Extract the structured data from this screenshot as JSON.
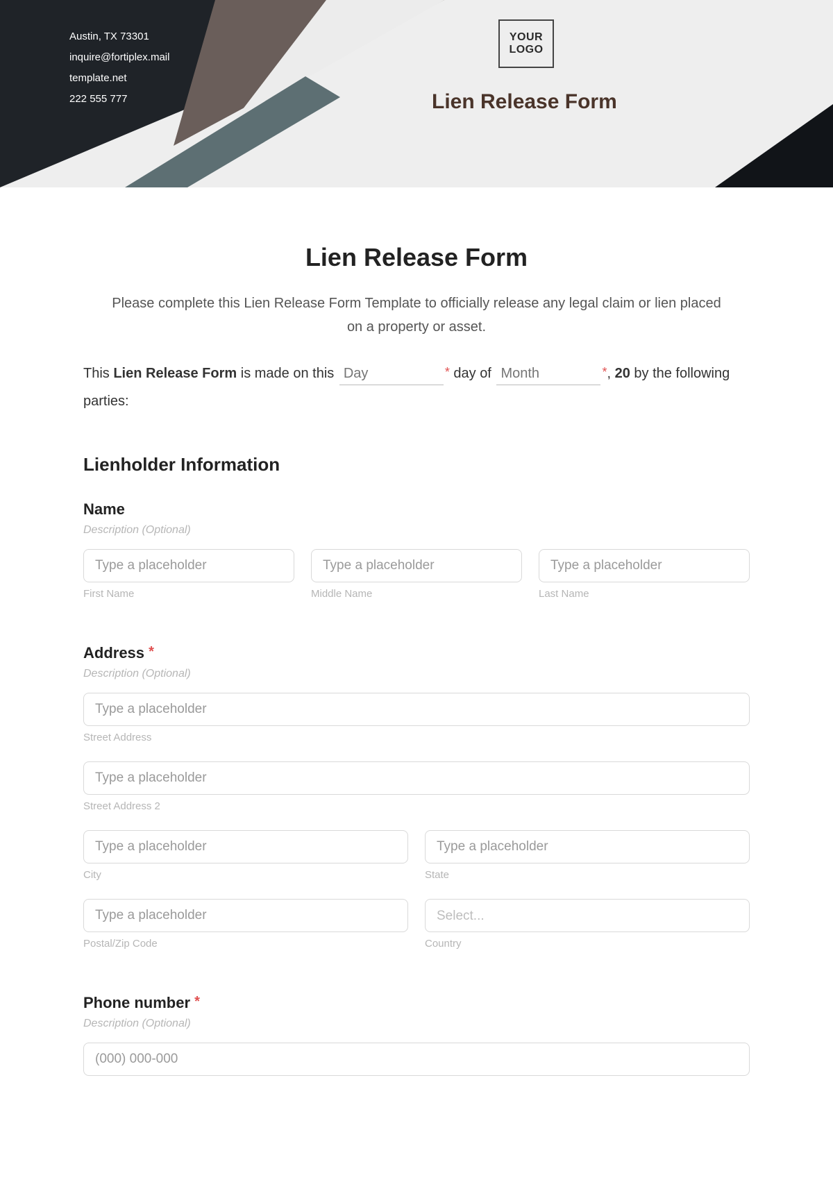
{
  "header": {
    "contact_line1": "Austin, TX 73301",
    "contact_line2": "inquire@fortiplex.mail",
    "contact_line3": "template.net",
    "contact_line4": "222 555 777",
    "logo_line1": "YOUR",
    "logo_line2": "LOGO",
    "title": "Lien Release Form"
  },
  "form": {
    "title": "Lien Release Form",
    "description": "Please complete this Lien Release Form Template to officially release any legal claim or lien placed on a property or asset.",
    "sentence_prefix": "This ",
    "sentence_bold": "Lien Release Form",
    "sentence_mid1": " is made on this ",
    "day_placeholder": "Day",
    "sentence_mid2": " day of ",
    "month_placeholder": "Month",
    "sentence_mid3": ", ",
    "year_prefix": "20",
    "sentence_suffix": " by the following parties:"
  },
  "sections": {
    "lienholder_heading": "Lienholder Information"
  },
  "name": {
    "label": "Name",
    "optional": "Description (Optional)",
    "first_placeholder": "Type a placeholder",
    "first_sub": "First Name",
    "middle_placeholder": "Type a placeholder",
    "middle_sub": "Middle Name",
    "last_placeholder": "Type a placeholder",
    "last_sub": "Last Name"
  },
  "address": {
    "label": "Address",
    "required_mark": "*",
    "optional": "Description (Optional)",
    "street1_placeholder": "Type a placeholder",
    "street1_sub": "Street Address",
    "street2_placeholder": "Type a placeholder",
    "street2_sub": "Street Address 2",
    "city_placeholder": "Type a placeholder",
    "city_sub": "City",
    "state_placeholder": "Type a placeholder",
    "state_sub": "State",
    "postal_placeholder": "Type a placeholder",
    "postal_sub": "Postal/Zip Code",
    "country_placeholder": "Select...",
    "country_sub": "Country"
  },
  "phone": {
    "label": "Phone number",
    "required_mark": "*",
    "optional": "Description (Optional)",
    "placeholder": "(000) 000-000"
  }
}
